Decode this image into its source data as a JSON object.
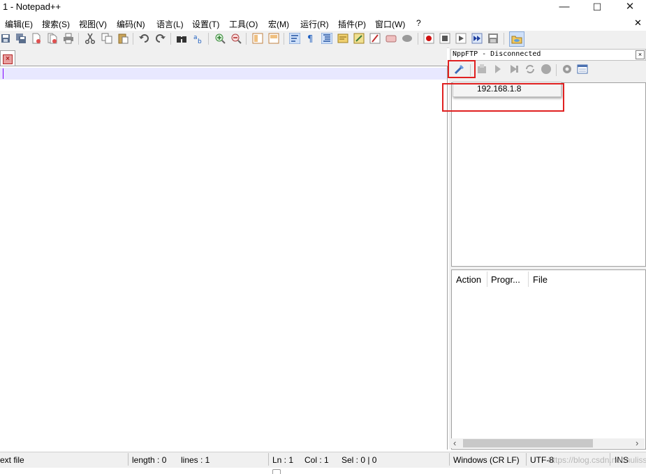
{
  "window": {
    "title": "1 - Notepad++",
    "controls": {
      "minimize": "—",
      "maximize": "☐",
      "close": "✕"
    }
  },
  "menu": {
    "items": [
      "编辑(E)",
      "搜索(S)",
      "视图(V)",
      "编码(N)",
      "语言(L)",
      "设置(T)",
      "工具(O)",
      "宏(M)",
      "运行(R)",
      "插件(P)",
      "窗口(W)",
      "?"
    ],
    "close_glyph": "✕"
  },
  "toolbar": {
    "icons": [
      "save-icon",
      "save-all-icon",
      "close-icon",
      "close-all-icon",
      "print-icon",
      "cut-icon",
      "copy-icon",
      "paste-icon",
      "undo-icon",
      "redo-icon",
      "find-icon",
      "replace-icon",
      "zoom-in-icon",
      "zoom-out-icon",
      "sync-v-icon",
      "sync-h-icon",
      "word-wrap-icon",
      "show-all-chars-icon",
      "indent-guide-icon",
      "doc-map-icon",
      "function-list-icon",
      "folder-workspace-icon",
      "monitoring-icon",
      "record-macro-icon",
      "stop-macro-icon",
      "play-macro-icon",
      "run-macro-multiple-icon",
      "save-macro-icon",
      "nppftp-icon"
    ]
  },
  "editor": {
    "tab_close_glyph": "×",
    "content": ""
  },
  "ftp": {
    "title": "NppFTP - Disconnected",
    "close_glyph": "×",
    "toolbar_icons": [
      "connect-icon",
      "download-icon",
      "upload-icon",
      "upload-alt-icon",
      "refresh-icon",
      "abort-icon",
      "settings-icon",
      "message-window-icon"
    ],
    "profile": "192.168.1.8",
    "queue_columns": [
      "Action",
      "Progr...",
      "File"
    ],
    "scroll_left": "‹",
    "scroll_right": "›"
  },
  "status": {
    "type": "ext file",
    "length": "length : 0",
    "lines": "lines : 1",
    "ln": "Ln : 1",
    "col": "Col : 1",
    "sel": "Sel : 0 | 0",
    "eol": "Windows (CR LF)",
    "encoding": "UTF-8",
    "mode": "INS"
  },
  "watermark": "https://blog.csdn.net/hulisse..."
}
